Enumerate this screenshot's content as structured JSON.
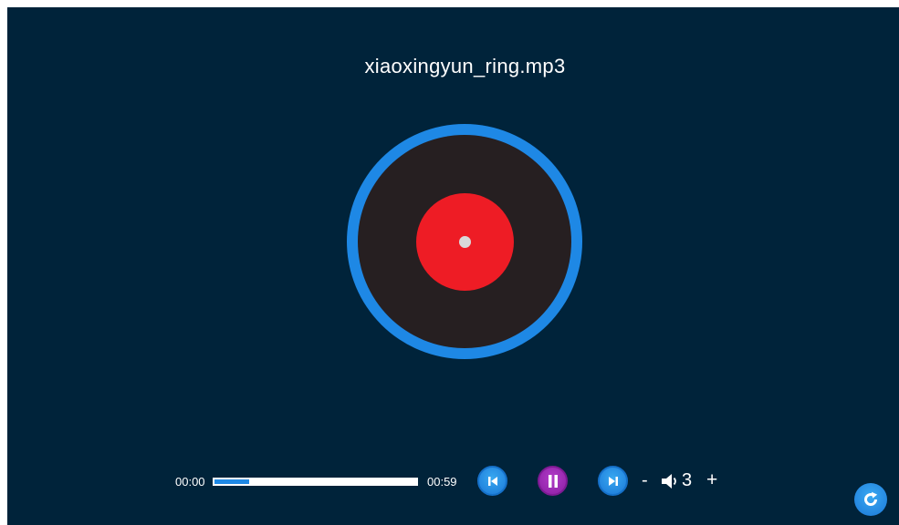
{
  "track": {
    "title": "xiaoxingyun_ring.mp3"
  },
  "playback": {
    "current_time": "00:00",
    "total_time": "00:59",
    "progress_fraction": 0.17
  },
  "volume": {
    "minus_label": "-",
    "plus_label": "+",
    "value": "3"
  },
  "icons": {
    "prev": "skip-previous-icon",
    "pause": "pause-icon",
    "next": "skip-next-icon",
    "volume": "speaker-icon",
    "refresh": "refresh-icon"
  },
  "colors": {
    "background": "#00233a",
    "accent": "#1e88e5",
    "disc": "#261f21",
    "disc_label": "#ee1c25",
    "pause_button": "#9c27b0"
  }
}
